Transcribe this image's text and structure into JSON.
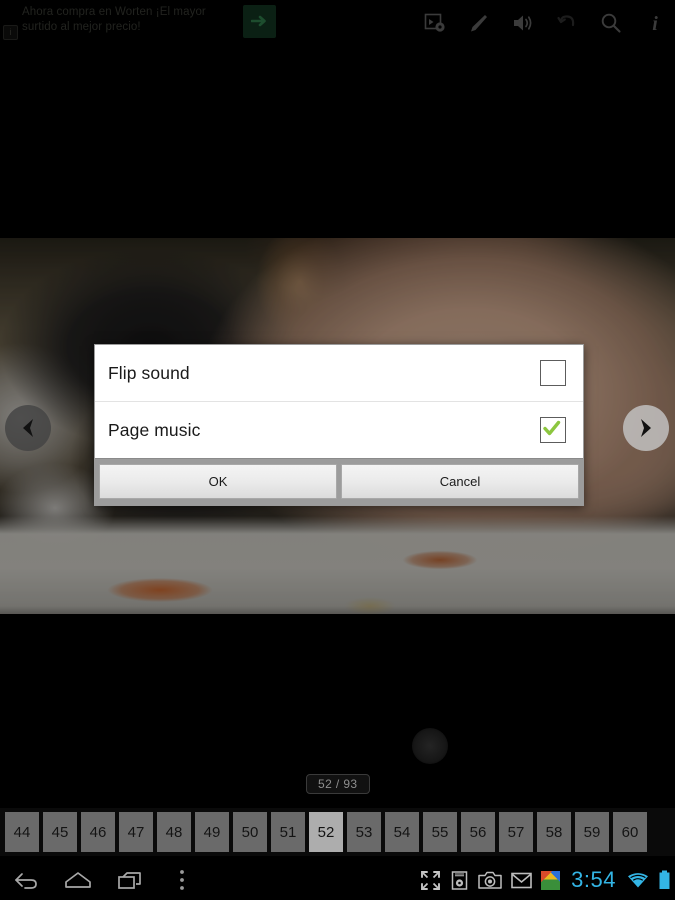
{
  "ad": {
    "badge": "i",
    "text": "Ahora compra en Worten ¡El mayor surtido al mejor precio!",
    "cta_icon": "arrow-right-icon"
  },
  "toolbar": {
    "items": [
      {
        "name": "slideshow-settings-icon",
        "label": "Slideshow settings",
        "enabled": true
      },
      {
        "name": "bookmark-icon",
        "label": "Bookmark",
        "enabled": true
      },
      {
        "name": "volume-icon",
        "label": "Sound",
        "enabled": true
      },
      {
        "name": "undo-icon",
        "label": "Undo",
        "enabled": false
      },
      {
        "name": "search-icon",
        "label": "Search",
        "enabled": true
      },
      {
        "name": "info-icon",
        "label": "Info",
        "enabled": true
      }
    ]
  },
  "viewer": {
    "prev_label": "Previous page",
    "next_label": "Next page",
    "page_indicator": "52 / 93",
    "current_page": 52,
    "total_pages": 93
  },
  "dialog": {
    "rows": [
      {
        "label": "Flip sound",
        "checked": false
      },
      {
        "label": "Page music",
        "checked": true
      }
    ],
    "ok_label": "OK",
    "cancel_label": "Cancel",
    "check_color": "#8cc63f"
  },
  "thumbnails": {
    "pages": [
      "44",
      "45",
      "46",
      "47",
      "48",
      "49",
      "50",
      "51",
      "52",
      "53",
      "54",
      "55",
      "56",
      "57",
      "58",
      "59",
      "60"
    ],
    "active": "52"
  },
  "system": {
    "nav": [
      {
        "name": "back-icon",
        "label": "Back"
      },
      {
        "name": "home-icon",
        "label": "Home"
      },
      {
        "name": "recents-icon",
        "label": "Recent apps"
      },
      {
        "name": "overflow-menu-icon",
        "label": "Menu"
      }
    ],
    "status": [
      {
        "name": "fullscreen-icon",
        "label": "Fullscreen"
      },
      {
        "name": "screenshot-icon",
        "label": "Screenshot"
      },
      {
        "name": "camera-icon",
        "label": "Camera"
      },
      {
        "name": "gmail-icon",
        "label": "Gmail"
      },
      {
        "name": "gallery-app-icon",
        "label": "Gallery"
      }
    ],
    "clock": "3:54",
    "wifi_label": "Wi-Fi",
    "battery_label": "Battery",
    "clock_color": "#33b5e5"
  }
}
